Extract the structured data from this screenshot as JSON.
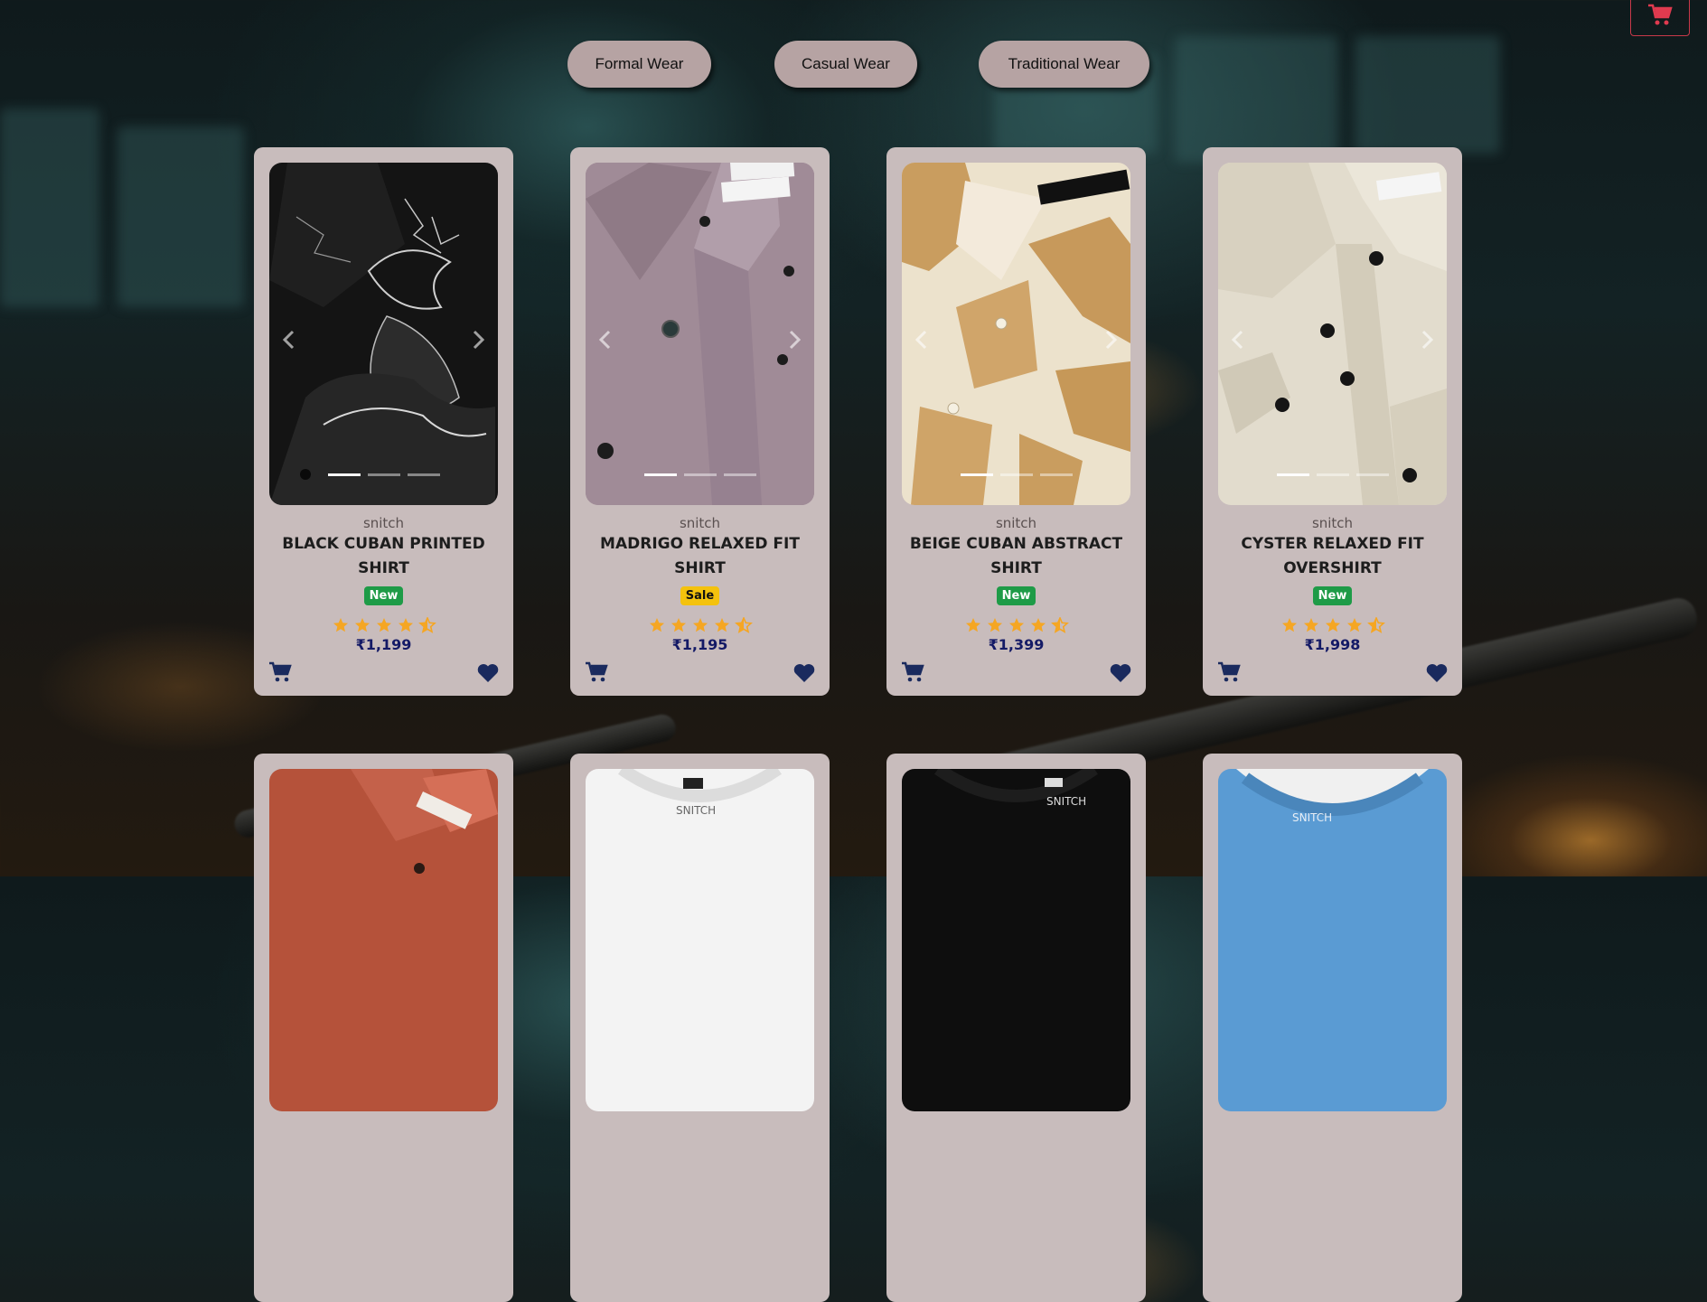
{
  "header": {
    "cart_icon": "shopping-cart-icon",
    "accent": "#c8394a"
  },
  "categories": [
    {
      "label": "Formal Wear"
    },
    {
      "label": "Casual Wear"
    },
    {
      "label": "Traditional Wear"
    }
  ],
  "products": [
    {
      "brand": "snitch",
      "name": "BLACK CUBAN PRINTED SHIRT",
      "badge": "New",
      "badge_color": "#1e9b47",
      "rating": 4.5,
      "price": "₹1,199",
      "image": "black-printed-shirt"
    },
    {
      "brand": "snitch",
      "name": "MADRIGO RELAXED FIT SHIRT",
      "badge": "Sale",
      "badge_color": "#f4c20d",
      "rating": 4.5,
      "price": "₹1,195",
      "image": "mauve-shirt"
    },
    {
      "brand": "snitch",
      "name": "BEIGE CUBAN ABSTRACT SHIRT",
      "badge": "New",
      "badge_color": "#1e9b47",
      "rating": 4.5,
      "price": "₹1,399",
      "image": "beige-abstract-shirt"
    },
    {
      "brand": "snitch",
      "name": "CYSTER RELAXED FIT OVERSHIRT",
      "badge": "New",
      "badge_color": "#1e9b47",
      "rating": 4.5,
      "price": "₹1,998",
      "image": "cream-overshirt"
    }
  ],
  "next_row_images": [
    "rust-shirt",
    "white-tshirt",
    "black-tshirt",
    "blue-tshirt"
  ],
  "colors": {
    "card_bg": "#c8bcbc",
    "price": "#141a66",
    "star": "#f5a623",
    "icon": "#1a2a5e",
    "category_button": "#b6a3a3"
  }
}
